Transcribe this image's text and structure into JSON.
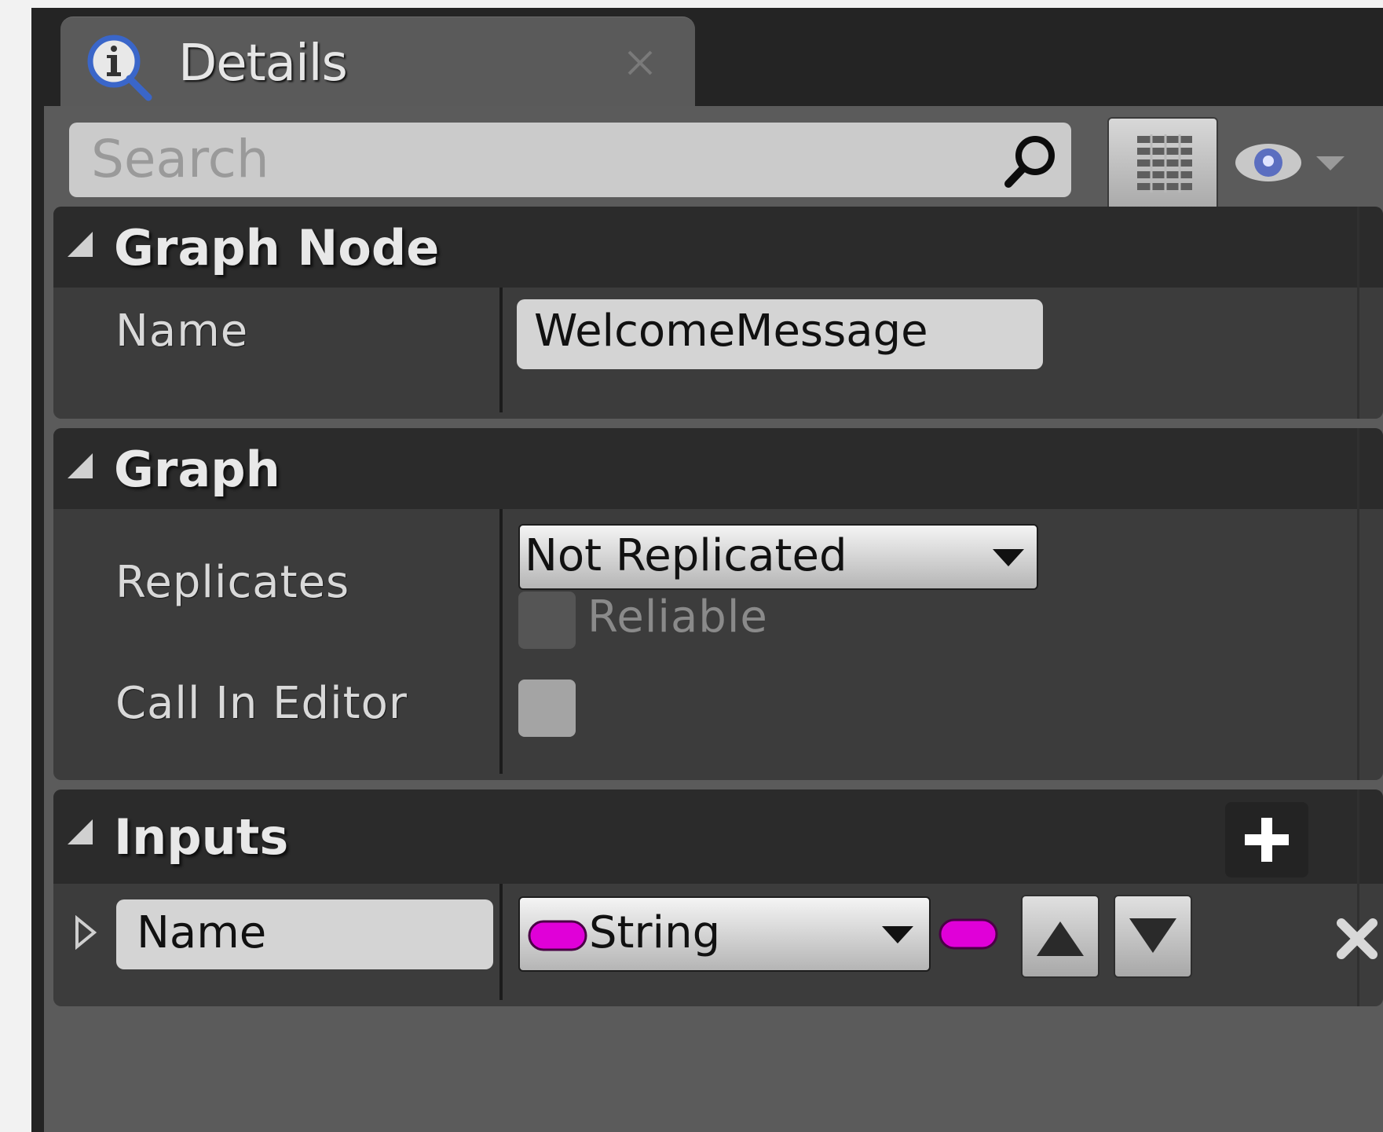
{
  "tab": {
    "title": "Details"
  },
  "search": {
    "placeholder": "Search"
  },
  "sections": {
    "graph_node": {
      "title": "Graph Node",
      "name_label": "Name",
      "name_value": "WelcomeMessage"
    },
    "graph": {
      "title": "Graph",
      "replicates_label": "Replicates",
      "replicates_value": "Not Replicated",
      "reliable_label": "Reliable",
      "call_in_editor_label": "Call In Editor"
    },
    "inputs": {
      "title": "Inputs",
      "param_name": "Name",
      "param_type": "String"
    }
  },
  "colors": {
    "panel_bg": "#242424",
    "section_bg": "#3c3c3c",
    "header_bg": "#2b2b2b",
    "string_pin": "#e000d8"
  }
}
